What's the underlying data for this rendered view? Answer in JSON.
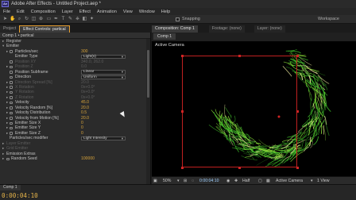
{
  "window": {
    "title": "Adobe After Effects - Untitled Project.aep *",
    "logo": "Ae"
  },
  "menu": [
    "File",
    "Edit",
    "Composition",
    "Layer",
    "Effect",
    "Animation",
    "View",
    "Window",
    "Help"
  ],
  "toolbar": {
    "snapping_label": "Snapping",
    "workspace_label": "Workspace"
  },
  "panels": {
    "project_tab": "Project",
    "effect_controls_tab": "Effect Controls: partical",
    "composition_tab": "Composition: Comp 1",
    "footage_tab": "Footage: (none)",
    "layer_tab": "Layer: (none)",
    "left_header": "Comp 1 • partical",
    "comp_subtab": "Comp 1"
  },
  "effect_controls": {
    "rows": [
      {
        "label": "Register",
        "value": ""
      },
      {
        "label": "Emitter",
        "value": ""
      },
      {
        "label": "Particles/sec",
        "value": "300"
      },
      {
        "label": "Emitter Type",
        "value": "Light(s)"
      },
      {
        "label": "Position XY",
        "value": "340.0, 262.0"
      },
      {
        "label": "Position Z",
        "value": "0.0"
      },
      {
        "label": "Position Subframe",
        "value": "Linear"
      },
      {
        "label": "Direction",
        "value": "Uniform"
      },
      {
        "label": "Direction Spread [%]",
        "value": "20.0"
      },
      {
        "label": "X Rotation",
        "value": "0x+0.0°"
      },
      {
        "label": "Y Rotation",
        "value": "0x+0.0°"
      },
      {
        "label": "Z Rotation",
        "value": "0x+0.0°"
      },
      {
        "label": "Velocity",
        "value": "45.0"
      },
      {
        "label": "Velocity Random [%]",
        "value": "20.0"
      },
      {
        "label": "Velocity Distribution",
        "value": "0.5"
      },
      {
        "label": "Velocity from Motion [%]",
        "value": "20.0"
      },
      {
        "label": "Emitter Size X",
        "value": "0"
      },
      {
        "label": "Emitter Size Y",
        "value": "0"
      },
      {
        "label": "Emitter Size Z",
        "value": "0"
      },
      {
        "label": "Particles/sec modifier",
        "value": "Light Intensity"
      },
      {
        "label": "Layer Emitter",
        "value": ""
      },
      {
        "label": "Grid Emitter",
        "value": ""
      },
      {
        "label": "Emission Extras",
        "value": ""
      },
      {
        "label": "Random Seed",
        "value": "100000"
      }
    ]
  },
  "composition": {
    "view_label": "Active Camera",
    "bottom_bar": {
      "zoom": "50%",
      "timecode": "0:00:04:10",
      "resolution": "Half",
      "camera": "Active Camera",
      "views": "1 View"
    }
  },
  "timeline": {
    "tab": "Comp 1",
    "timecode": "0:00:04:10"
  },
  "colors": {
    "accent": "#e8a030",
    "value": "#d7a33a",
    "bbox": "#c02020",
    "timecode": "#e6b44a"
  }
}
